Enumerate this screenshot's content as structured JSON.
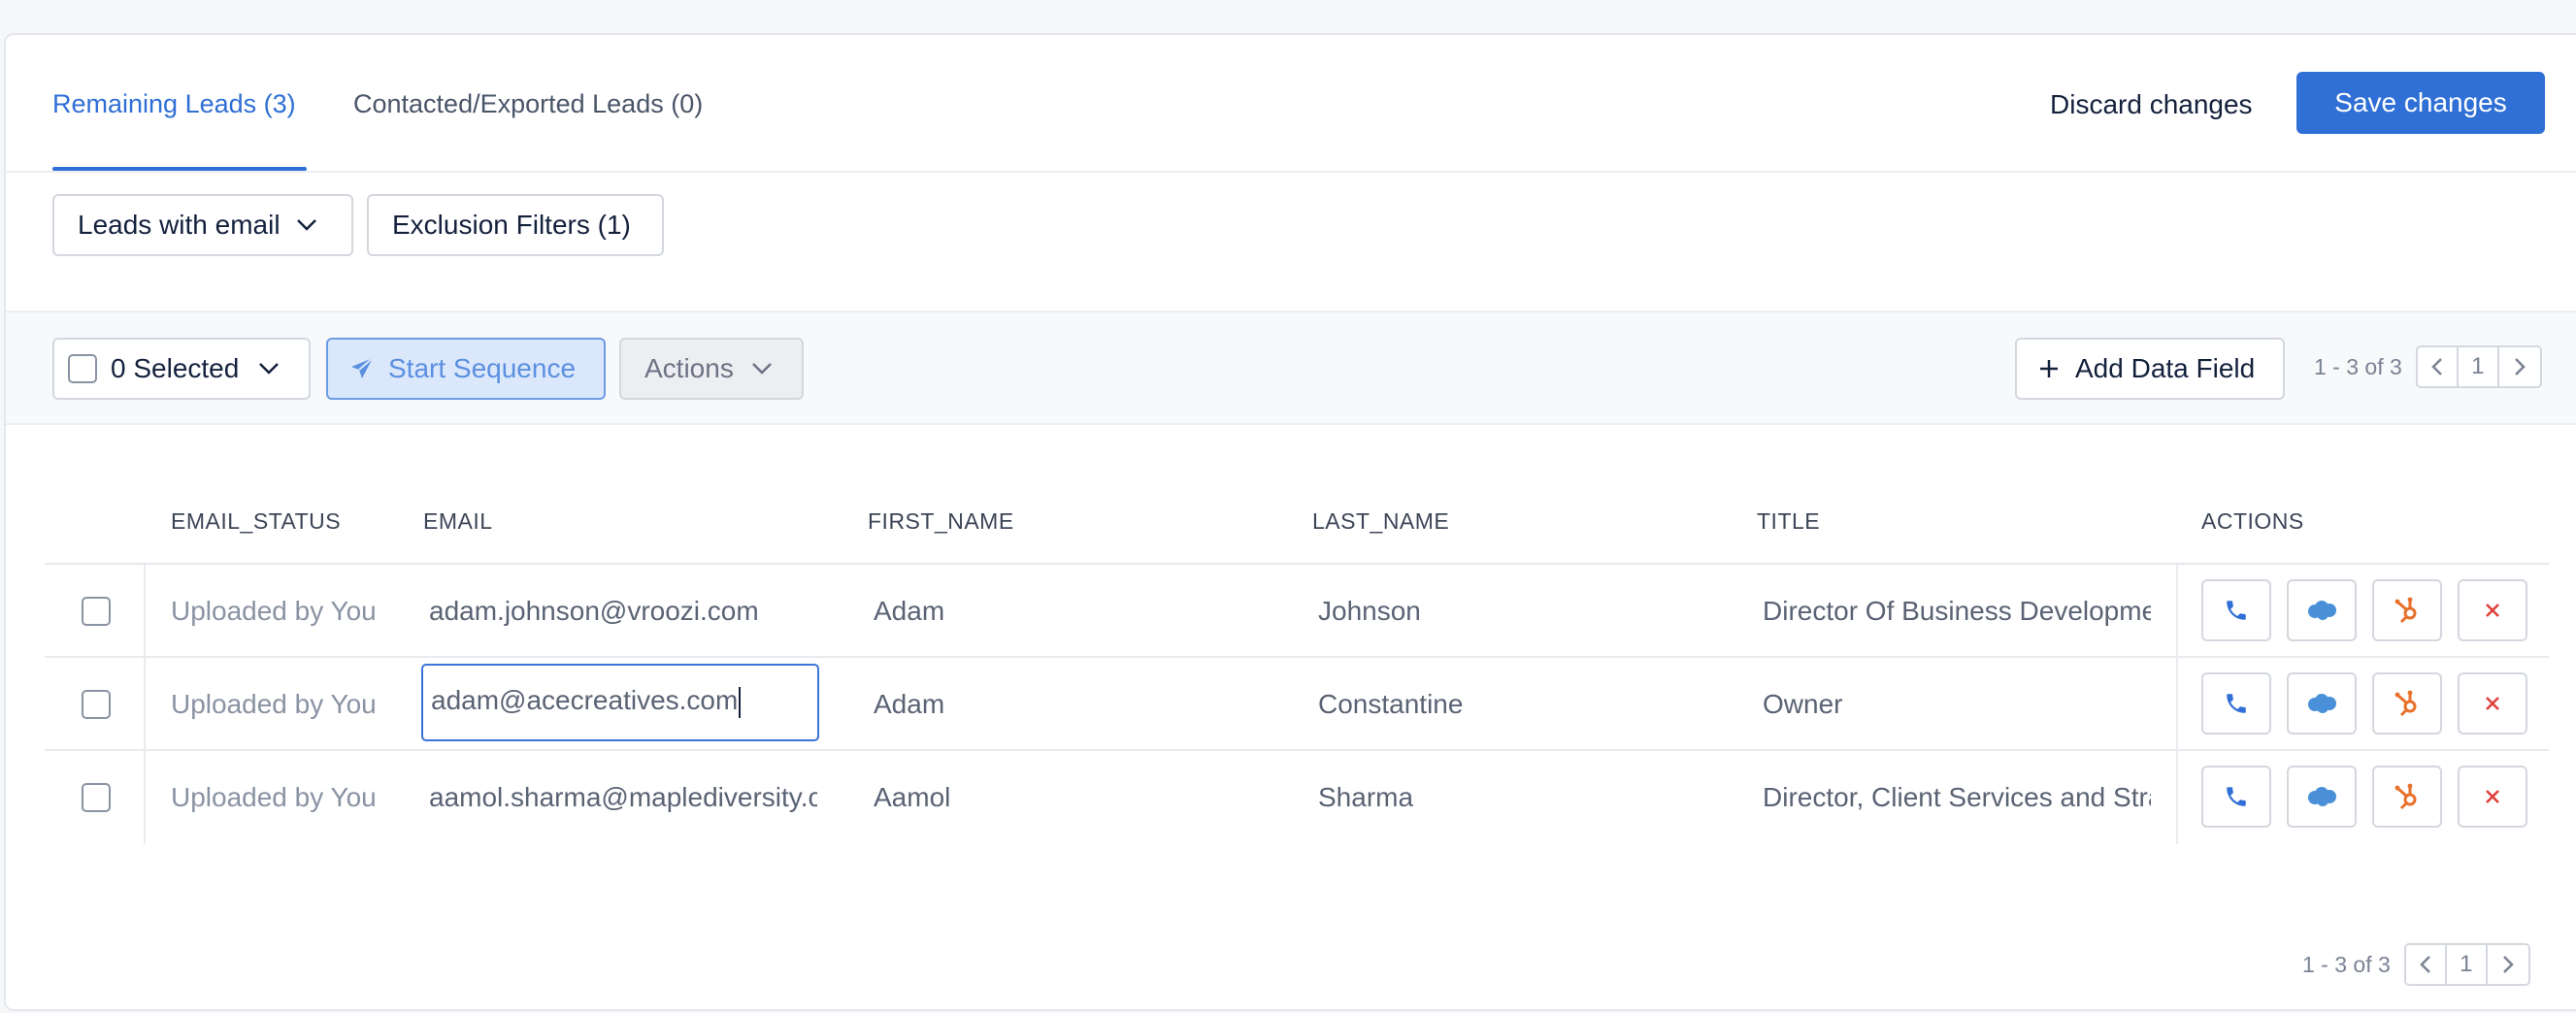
{
  "tabs": [
    {
      "label": "Remaining Leads (3)",
      "active": true
    },
    {
      "label": "Contacted/Exported Leads (0)",
      "active": false
    }
  ],
  "header": {
    "discard_label": "Discard changes",
    "save_label": "Save changes"
  },
  "filters": {
    "leads_filter": "Leads with email",
    "exclusion_filter": "Exclusion Filters (1)"
  },
  "toolbar": {
    "selected_label": "0 Selected",
    "start_sequence": "Start Sequence",
    "actions": "Actions",
    "add_data_field": "Add Data Field"
  },
  "pagination": {
    "range": "1 - 3 of 3",
    "page": "1"
  },
  "table": {
    "columns": [
      "EMAIL_STATUS",
      "EMAIL",
      "FIRST_NAME",
      "LAST_NAME",
      "TITLE",
      "ACTIONS"
    ],
    "rows": [
      {
        "email_status": "Uploaded by You",
        "email": "adam.johnson@vroozi.com",
        "first_name": "Adam",
        "last_name": "Johnson",
        "title": "Director Of Business Developme"
      },
      {
        "email_status": "Uploaded by You",
        "email": "adam@acecreatives.com",
        "first_name": "Adam",
        "last_name": "Constantine",
        "title": "Owner"
      },
      {
        "email_status": "Uploaded by You",
        "email": "aamol.sharma@maplediversity.c",
        "first_name": "Aamol",
        "last_name": "Sharma",
        "title": "Director, Client Services and Stra"
      }
    ]
  },
  "icons": {
    "phone": "phone-icon",
    "salesforce": "salesforce-cloud-icon",
    "hubspot": "hubspot-icon",
    "remove": "close-icon"
  },
  "colors": {
    "accent": "#2f6fd6",
    "salesforce": "#4a90d9",
    "hubspot": "#e8702a",
    "remove": "#e0403a"
  }
}
